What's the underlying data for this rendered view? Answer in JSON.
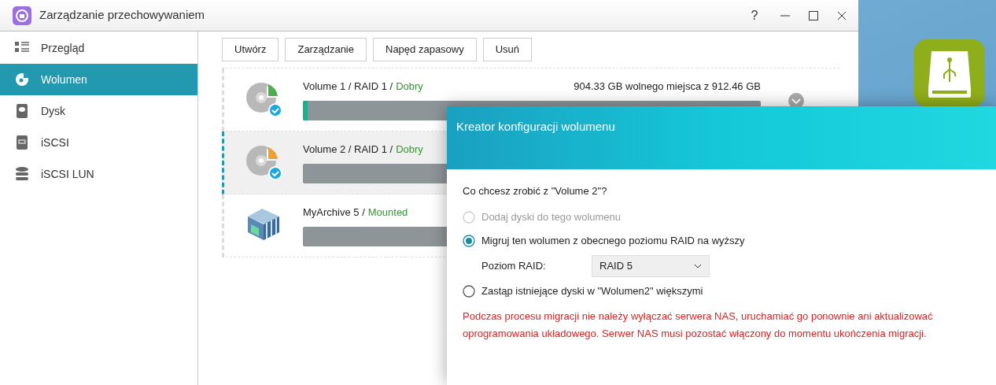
{
  "window": {
    "title": "Zarządzanie przechowywaniem",
    "controls": [
      "?"
    ]
  },
  "sidebar": {
    "items": [
      {
        "label": "Przegląd",
        "kind": "list",
        "selected": false
      },
      {
        "label": "Wolumen",
        "kind": "disc",
        "selected": true
      },
      {
        "label": "Dysk",
        "kind": "drive",
        "selected": false
      },
      {
        "label": "iSCSI",
        "kind": "iscsi",
        "selected": false
      },
      {
        "label": "iSCSI LUN",
        "kind": "db",
        "selected": false
      }
    ]
  },
  "toolbar": [
    "Utwórz",
    "Zarządzanie",
    "Napęd zapasowy",
    "Usuń"
  ],
  "volumes": [
    {
      "kind": "volume",
      "color": "#4caf50",
      "title": "Volume 1 / RAID 1 /",
      "status": "Dobry",
      "free": "904.33 GB wolnego miejsca z 912.46 GB",
      "level": 0.01,
      "selected": false
    },
    {
      "kind": "volume",
      "color": "#f0a030",
      "title": "Volume 2 / RAID 1 /",
      "status": "Dobry",
      "level": 0,
      "selected": true
    },
    {
      "kind": "archive",
      "title": "MyArchive 5 /",
      "status": "Mounted",
      "level": 0,
      "selected": false
    }
  ],
  "dialog": {
    "title": "Kreator konfiguracji wolumenu",
    "question": "Co chcesz zrobić z \"Volume 2\"?",
    "options": [
      {
        "label": "Dodaj dyski do tego wolumenu",
        "selected": false,
        "disabled": true
      },
      {
        "label": "Migruj ten wolumen z obecnego poziomu RAID na wyższy",
        "selected": true,
        "disabled": false,
        "field": {
          "label": "Poziom RAID:",
          "value": "RAID 5"
        }
      },
      {
        "label": "Zastąp istniejące dyski w \"Wolumen2\" większymi",
        "selected": false,
        "disabled": false
      }
    ],
    "warning": "Podczas procesu migracji nie należy wyłączać serwera NAS, uruchamiać go ponownie ani aktualizować oprogramowania układowego. Serwer NAS musi pozostać włączony do momentu ukończenia migracji."
  }
}
